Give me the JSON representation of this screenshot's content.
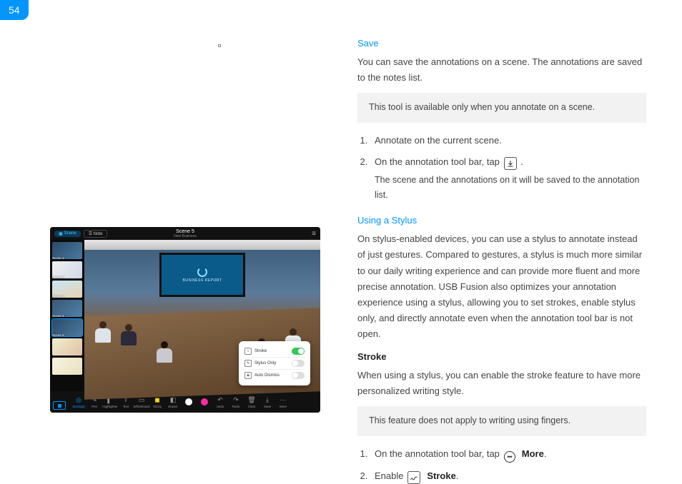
{
  "page_number": "54",
  "save": {
    "heading": "Save",
    "intro": "You can save the annotations on a scene. The annotations are saved to the notes list.",
    "note": "This tool is available only when you annotate on a scene.",
    "step1": "Annotate on the current scene.",
    "step2_a": "On the annotation tool bar, tap ",
    "step2_b": " .",
    "step2_sub": "The scene and the annotations on it will be saved to the annotation list."
  },
  "stylus": {
    "heading": "Using a Stylus",
    "intro": "On stylus-enabled devices, you can use a stylus to annotate instead of just gestures. Compared to gestures, a stylus is much more similar to our daily writing experience and can provide more fluent and more precise annotation. USB Fusion also optimizes your annotation experience using a stylus, allowing you to set strokes, enable stylus only, and directly annotate even when the annotation tool bar is not open.",
    "stroke_head": "Stroke",
    "stroke_body": "When using a stylus, you can enable the stroke feature to have more personalized writing style.",
    "stroke_note": "This feature does not apply to writing using fingers.",
    "s1_a": "On the annotation tool bar, tap ",
    "s1_more": "More",
    "s2_a": "Enable ",
    "s2_stroke": "Stroke"
  },
  "app": {
    "tab_scene": "Scene",
    "tab_note": "Note",
    "title": "Scene 5",
    "subtitle": "New Business",
    "thumbs": [
      {
        "label": "Scene 1"
      },
      {
        "label": "Scene 2"
      },
      {
        "label": "Scene 3"
      },
      {
        "label": "Scene 4"
      },
      {
        "label": "Scene 5"
      },
      {
        "label": ""
      },
      {
        "label": ""
      }
    ],
    "screen_text": "BUSINESS REPORT",
    "popup": {
      "row1": "Stroke",
      "row2": "Stylus Only",
      "row3": "Auto Dismiss"
    },
    "toolbar": {
      "t1": "Spotlight",
      "t2": "Pen",
      "t3": "Highlighter",
      "t4": "Text",
      "t5": "Whiteboard",
      "t6": "Sticky",
      "t7": "Eraser",
      "t8": "",
      "t9": "",
      "t10": "Undo",
      "t11": "Redo",
      "t12": "Clear",
      "t13": "Save",
      "t14": "More"
    }
  }
}
